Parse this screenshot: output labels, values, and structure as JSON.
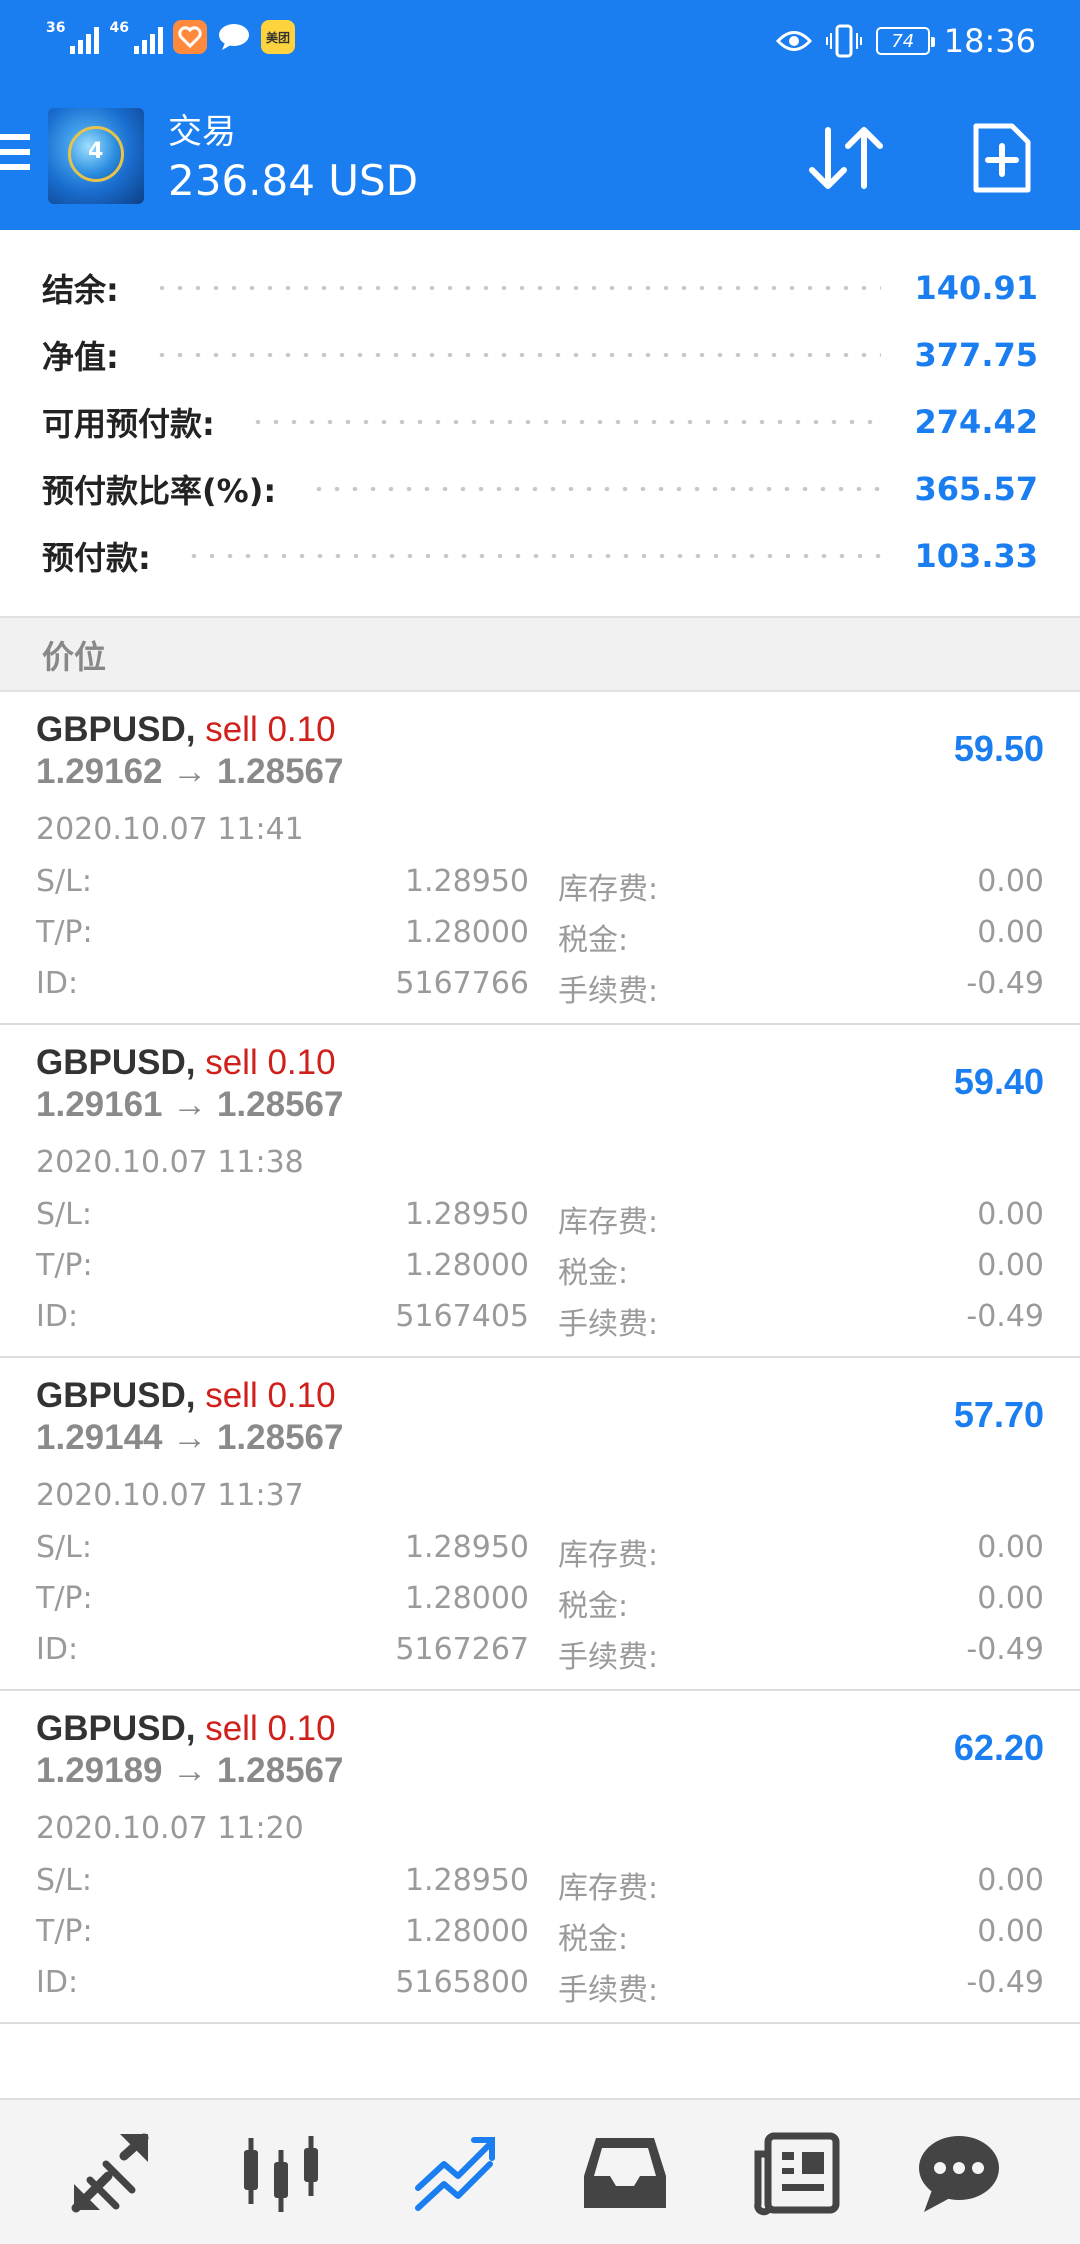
{
  "status_bar": {
    "signal1": "36",
    "signal2": "46",
    "meituan": "美团",
    "battery": "74",
    "time": "18:36"
  },
  "app_bar": {
    "title": "交易",
    "balance": "236.84 USD",
    "icons": [
      "menu-icon",
      "metatrader-logo",
      "sort-icon",
      "new-order-icon"
    ]
  },
  "summary": [
    {
      "label": "结余:",
      "value": "140.91"
    },
    {
      "label": "净值:",
      "value": "377.75"
    },
    {
      "label": "可用预付款:",
      "value": "274.42"
    },
    {
      "label": "预付款比率(%):",
      "value": "365.57"
    },
    {
      "label": "预付款:",
      "value": "103.33"
    }
  ],
  "section_title": "价位",
  "positions": [
    {
      "symbol": "GBPUSD,",
      "side": "sell 0.10",
      "prices": "1.29162 → 1.28567",
      "profit": "59.50",
      "time": "2020.10.07 11:41",
      "sl_label": "S/L:",
      "sl": "1.28950",
      "swap_label": "库存费:",
      "swap": "0.00",
      "tp_label": "T/P:",
      "tp": "1.28000",
      "tax_label": "税金:",
      "tax": "0.00",
      "id_label": "ID:",
      "id": "5167766",
      "fee_label": "手续费:",
      "fee": "-0.49"
    },
    {
      "symbol": "GBPUSD,",
      "side": "sell 0.10",
      "prices": "1.29161 → 1.28567",
      "profit": "59.40",
      "time": "2020.10.07 11:38",
      "sl_label": "S/L:",
      "sl": "1.28950",
      "swap_label": "库存费:",
      "swap": "0.00",
      "tp_label": "T/P:",
      "tp": "1.28000",
      "tax_label": "税金:",
      "tax": "0.00",
      "id_label": "ID:",
      "id": "5167405",
      "fee_label": "手续费:",
      "fee": "-0.49"
    },
    {
      "symbol": "GBPUSD,",
      "side": "sell 0.10",
      "prices": "1.29144 → 1.28567",
      "profit": "57.70",
      "time": "2020.10.07 11:37",
      "sl_label": "S/L:",
      "sl": "1.28950",
      "swap_label": "库存费:",
      "swap": "0.00",
      "tp_label": "T/P:",
      "tp": "1.28000",
      "tax_label": "税金:",
      "tax": "0.00",
      "id_label": "ID:",
      "id": "5167267",
      "fee_label": "手续费:",
      "fee": "-0.49"
    },
    {
      "symbol": "GBPUSD,",
      "side": "sell 0.10",
      "prices": "1.29189 → 1.28567",
      "profit": "62.20",
      "time": "2020.10.07 11:20",
      "sl_label": "S/L:",
      "sl": "1.28950",
      "swap_label": "库存费:",
      "swap": "0.00",
      "tp_label": "T/P:",
      "tp": "1.28000",
      "tax_label": "税金:",
      "tax": "0.00",
      "id_label": "ID:",
      "id": "5165800",
      "fee_label": "手续费:",
      "fee": "-0.49"
    }
  ],
  "bottom_nav": {
    "items": [
      "quotes-icon",
      "chart-icon",
      "trade-icon",
      "history-icon",
      "news-icon",
      "chat-icon"
    ],
    "active": "trade-icon"
  },
  "colors": {
    "accent": "#1b7ef0",
    "sell": "#d0201b",
    "muted": "#9a9a9a"
  }
}
